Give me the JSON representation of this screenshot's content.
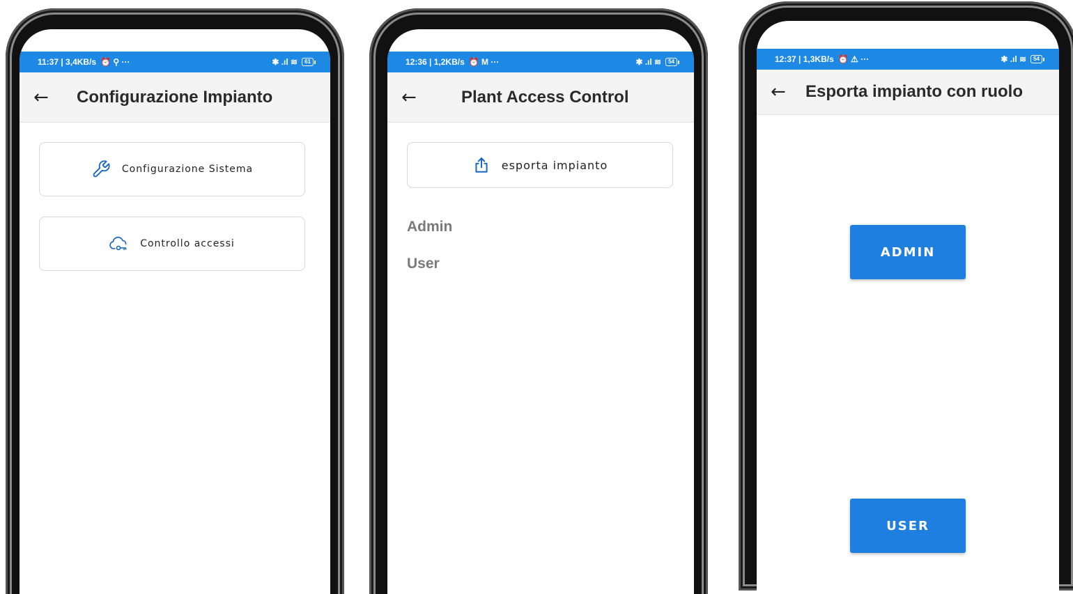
{
  "phone1": {
    "status": {
      "time": "11:37 | 3,4KB/s",
      "extra": "⏰ ⚲ ···",
      "signal": "✱ .ıl ≋",
      "battery": "61"
    },
    "title": "Configurazione Impianto",
    "buttons": [
      {
        "label": "Configurazione Sistema",
        "icon": "wrench-icon"
      },
      {
        "label": "Controllo accessi",
        "icon": "cloud-key-icon"
      }
    ]
  },
  "phone2": {
    "status": {
      "time": "12:36 | 1,2KB/s",
      "extra": "⏰ M ···",
      "signal": "✱ .ıl ≋",
      "battery": "54"
    },
    "title": "Plant Access Control",
    "export_button": {
      "label": "esporta impianto",
      "icon": "share-upload-icon"
    },
    "roles": [
      "Admin",
      "User"
    ]
  },
  "phone3": {
    "status": {
      "time": "12:37 | 1,3KB/s",
      "extra": "⏰ ⚠ ···",
      "signal": "✱ .ıl ≋",
      "battery": "54"
    },
    "title": "Esporta impianto con ruolo",
    "buttons": [
      "ADMIN",
      "USER"
    ]
  },
  "colors": {
    "status_bar": "#1e88e5",
    "primary_button": "#1e7fe0",
    "icon_blue": "#1565c0"
  }
}
